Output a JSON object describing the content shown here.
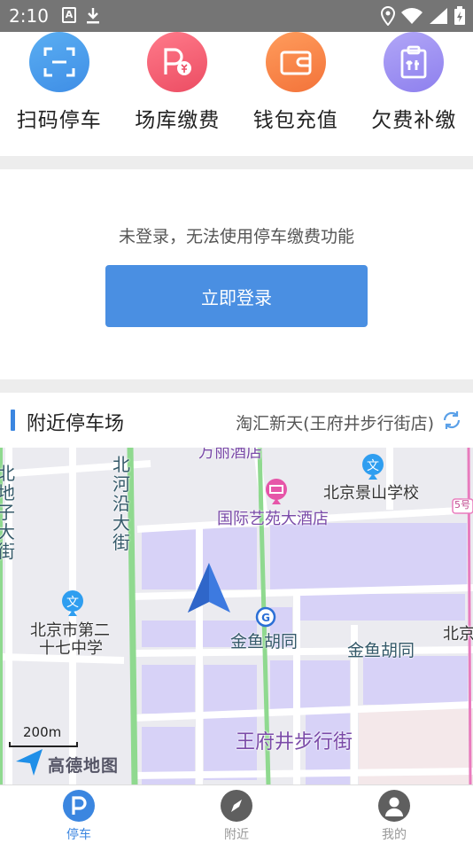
{
  "status_bar": {
    "time": "2:10",
    "left_icons": [
      "text-icon",
      "download-icon"
    ],
    "right_icons": [
      "location-icon",
      "wifi-icon",
      "signal-icon",
      "battery-icon"
    ],
    "text_icon_glyph": "A"
  },
  "shortcuts": [
    {
      "label": "扫码停车",
      "icon": "scan-icon",
      "color": "#4a9bea"
    },
    {
      "label": "场库缴费",
      "icon": "parking-pay-icon",
      "color": "#f05a6e"
    },
    {
      "label": "钱包充值",
      "icon": "wallet-icon",
      "color": "#f7854a"
    },
    {
      "label": "欠费补缴",
      "icon": "clipboard-icon",
      "color": "#9d8ff2"
    }
  ],
  "login": {
    "message": "未登录，无法使用停车缴费功能",
    "button_label": "立即登录"
  },
  "nearby": {
    "title": "附近停车场",
    "location": "淘汇新天(王府井步行街店)"
  },
  "map": {
    "labels": {
      "top_hotel": "万丽酒店",
      "school1": "北京景山学校",
      "hotel": "国际艺苑大酒店",
      "school2_line1": "北京市第二",
      "school2_line2": "十七中学",
      "hutong1": "金鱼胡同",
      "hutong2": "金鱼胡同",
      "pedestrian": "王府井步行街",
      "road_vert1": "北河沿大街",
      "road_vert2": "北地子大街",
      "right_edge": "北京",
      "line_badge": "5号"
    },
    "scale": "200m",
    "brand": "高德地图"
  },
  "bottom_nav": [
    {
      "label": "停车",
      "icon": "parking-icon",
      "active": true
    },
    {
      "label": "附近",
      "icon": "compass-icon",
      "active": false
    },
    {
      "label": "我的",
      "icon": "user-icon",
      "active": false
    }
  ],
  "colors": {
    "accent": "#3b86e0",
    "inactive_nav": "#5f5f5f",
    "inactive_label": "#999999"
  }
}
